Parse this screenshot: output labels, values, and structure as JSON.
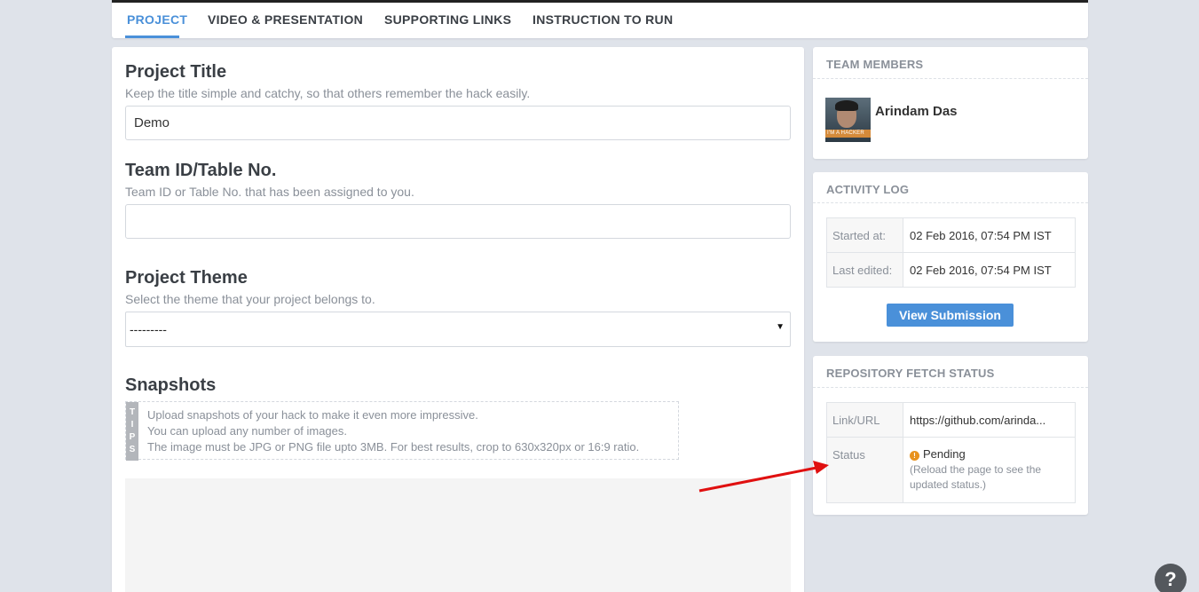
{
  "tabs": [
    {
      "label": "PROJECT",
      "active": true
    },
    {
      "label": "VIDEO & PRESENTATION",
      "active": false
    },
    {
      "label": "SUPPORTING LINKS",
      "active": false
    },
    {
      "label": "INSTRUCTION TO RUN",
      "active": false
    }
  ],
  "form": {
    "project_title": {
      "label": "Project Title",
      "help": "Keep the title simple and catchy, so that others remember the hack easily.",
      "value": "Demo"
    },
    "team_id": {
      "label": "Team ID/Table No.",
      "help": "Team ID or Table No. that has been assigned to you.",
      "value": ""
    },
    "project_theme": {
      "label": "Project Theme",
      "help": "Select the theme that your project belongs to.",
      "selected": "---------"
    },
    "snapshots": {
      "label": "Snapshots",
      "tips_label": "TIPS",
      "tips": [
        "Upload snapshots of your hack to make it even more impressive.",
        "You can upload any number of images.",
        "The image must be JPG or PNG file upto 3MB. For best results, crop to 630x320px or 16:9 ratio."
      ]
    }
  },
  "team_members": {
    "header": "TEAM MEMBERS",
    "members": [
      {
        "name": "Arindam Das",
        "avatar_caption": "I'M A HACKER"
      }
    ]
  },
  "activity_log": {
    "header": "ACTIVITY LOG",
    "rows": [
      {
        "key": "Started at:",
        "value": "02 Feb 2016, 07:54 PM IST"
      },
      {
        "key": "Last edited:",
        "value": "02 Feb 2016, 07:54 PM IST"
      }
    ],
    "button": "View Submission"
  },
  "repository_status": {
    "header": "REPOSITORY FETCH STATUS",
    "link_key": "Link/URL",
    "link_value": "https://github.com/arinda...",
    "status_key": "Status",
    "status_value": "Pending",
    "status_icon": "!",
    "status_note": "(Reload the page to see the updated status.)"
  },
  "help_button": "?",
  "colors": {
    "accent": "#4a90d9",
    "warning": "#e8921e",
    "arrow": "#e01010"
  }
}
